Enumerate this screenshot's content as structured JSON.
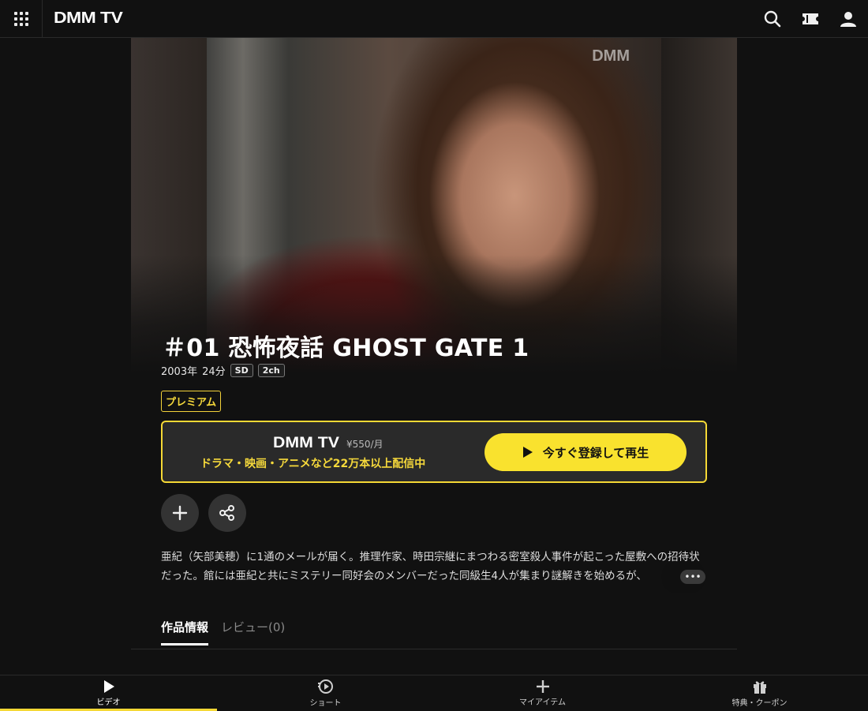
{
  "header": {
    "logo": "DMM TV",
    "icons": [
      "menu-grid-icon",
      "search-icon",
      "ticket-icon",
      "user-icon"
    ]
  },
  "hero": {
    "watermark": "DMM"
  },
  "title": "＃01 恐怖夜話 GHOST GATE 1",
  "meta": {
    "year": "2003年",
    "duration": "24分",
    "quality": "SD",
    "audio": "2ch"
  },
  "premium_badge": "プレミアム",
  "promo": {
    "logo": "DMM TV",
    "price": "¥550/月",
    "text": "ドラマ・映画・アニメなど22万本以上配信中",
    "button_label": "今すぐ登録して再生",
    "accent_color": "#f5d835"
  },
  "actions": {
    "add_icon": "plus-icon",
    "share_icon": "share-icon"
  },
  "description": "亜紀（矢部美穂）に1通のメールが届く。推理作家、時田宗継にまつわる密室殺人事件が起こった屋敷への招待状だった。館には亜紀と共にミステリー同好会のメンバーだった同級生4人が集まり謎解きを始めるが、",
  "more_label": "•••",
  "tabs": [
    {
      "label": "作品情報",
      "active": true
    },
    {
      "label": "レビュー(0)",
      "active": false
    }
  ],
  "bottom_nav": [
    {
      "label": "ビデオ",
      "icon": "play-icon",
      "active": true
    },
    {
      "label": "ショート",
      "icon": "short-play-icon",
      "active": false
    },
    {
      "label": "マイアイテム",
      "icon": "plus-icon",
      "active": false
    },
    {
      "label": "特典・クーポン",
      "icon": "gift-icon",
      "active": false
    }
  ]
}
